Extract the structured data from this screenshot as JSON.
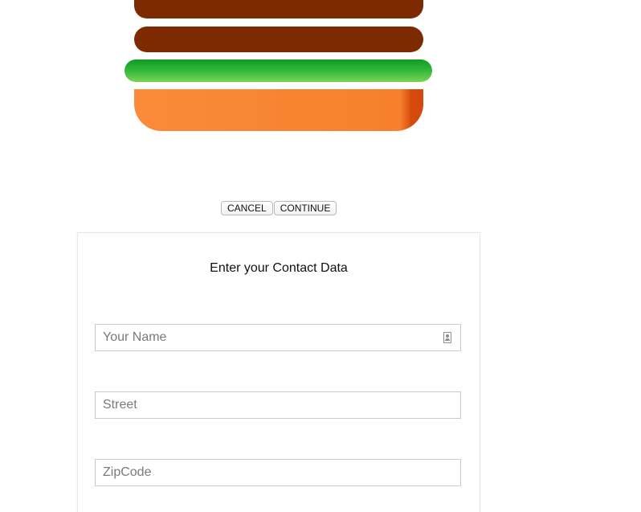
{
  "buttons": {
    "cancel_label": "CANCEL",
    "continue_label": "CONTINUE"
  },
  "form": {
    "title": "Enter your Contact Data",
    "name_placeholder": "Your Name",
    "street_placeholder": "Street",
    "zip_placeholder": "ZipCode"
  },
  "colors": {
    "patty": "#7e2a00",
    "lettuce": "#2eb53a",
    "bun": "#f6802c"
  },
  "icons": {
    "name_field_icon": "contact-card-icon"
  }
}
